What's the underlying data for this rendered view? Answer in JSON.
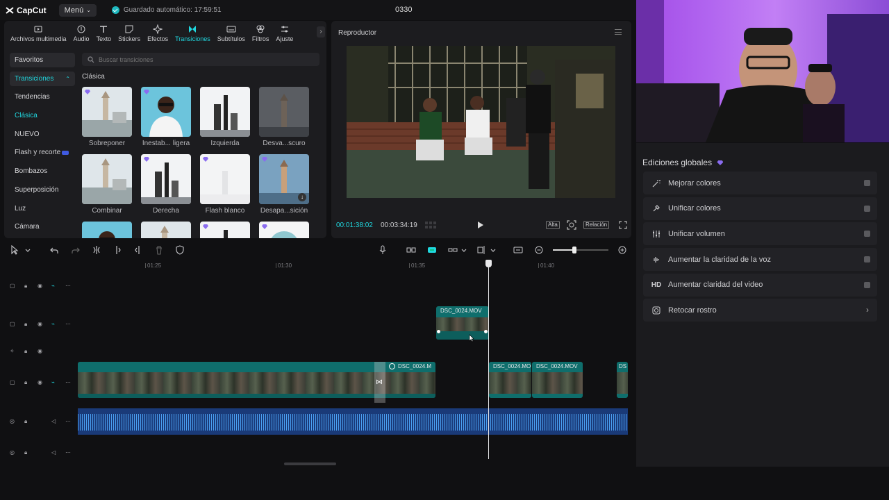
{
  "topbar": {
    "logo": "CapCut",
    "menu_label": "Menú",
    "autosave": "Guardado automático: 17:59:51",
    "project_title": "0330"
  },
  "tools": [
    {
      "label": "Archivos multimedia",
      "icon": "media-icon",
      "active": false
    },
    {
      "label": "Audio",
      "icon": "audio-icon",
      "active": false
    },
    {
      "label": "Texto",
      "icon": "text-icon",
      "active": false
    },
    {
      "label": "Stickers",
      "icon": "sticker-icon",
      "active": false
    },
    {
      "label": "Efectos",
      "icon": "effects-icon",
      "active": false
    },
    {
      "label": "Transiciones",
      "icon": "transitions-icon",
      "active": true
    },
    {
      "label": "Subtítulos",
      "icon": "subtitles-icon",
      "active": false
    },
    {
      "label": "Filtros",
      "icon": "filters-icon",
      "active": false
    },
    {
      "label": "Ajuste",
      "icon": "adjust-icon",
      "active": false
    }
  ],
  "categories": [
    {
      "label": "Favoritos",
      "selected": true
    },
    {
      "label": "Transiciones",
      "selected": true,
      "teal": true,
      "expanded": true
    },
    {
      "label": "Tendencias"
    },
    {
      "label": "Clásica",
      "teal": true
    },
    {
      "label": "NUEVO"
    },
    {
      "label": "Flash y recorte",
      "vip": true
    },
    {
      "label": "Bombazos"
    },
    {
      "label": "Superposición"
    },
    {
      "label": "Luz"
    },
    {
      "label": "Cámara"
    }
  ],
  "search": {
    "placeholder": "Buscar transiciones"
  },
  "section_label": "Clásica",
  "transitions": [
    {
      "label": "Sobreponer",
      "kind": "lighthouse-city",
      "premium": true
    },
    {
      "label": "Inestab... ligera",
      "kind": "person",
      "premium": true
    },
    {
      "label": "Izquierda",
      "kind": "tower",
      "premium": false
    },
    {
      "label": "Desva...scuro",
      "kind": "dark-tower",
      "premium": false
    },
    {
      "label": "Combinar",
      "kind": "lighthouse-city",
      "premium": false
    },
    {
      "label": "Derecha",
      "kind": "tower",
      "premium": true
    },
    {
      "label": "Flash blanco",
      "kind": "white",
      "premium": true
    },
    {
      "label": "Desapa...sición",
      "kind": "lighthouse-blue",
      "premium": true,
      "download": true
    },
    {
      "label": "",
      "kind": "person",
      "premium": false
    },
    {
      "label": "",
      "kind": "lighthouse-city",
      "premium": false
    },
    {
      "label": "",
      "kind": "tower",
      "premium": true
    },
    {
      "label": "",
      "kind": "circle",
      "premium": true
    }
  ],
  "player": {
    "title": "Reproductor",
    "current_time": "00:01:38:02",
    "total_time": "00:03:34:19",
    "quality": "Alta",
    "ratio": "Relación"
  },
  "global_edits": {
    "title": "Ediciones globales",
    "items": [
      {
        "label": "Mejorar colores",
        "icon": "magic-wand-icon",
        "type": "toggle"
      },
      {
        "label": "Unificar colores",
        "icon": "color-dropper-icon",
        "type": "toggle"
      },
      {
        "label": "Unificar volumen",
        "icon": "sliders-icon",
        "type": "toggle"
      },
      {
        "label": "Aumentar la claridad de la voz",
        "icon": "voice-sparkle-icon",
        "type": "toggle"
      },
      {
        "label": "Aumentar claridad del video",
        "icon": "hd-icon",
        "icon_text": "HD",
        "type": "toggle"
      },
      {
        "label": "Retocar rostro",
        "icon": "face-retouch-icon",
        "type": "arrow"
      }
    ]
  },
  "timeline": {
    "ruler": [
      "01:25",
      "01:30",
      "01:35",
      "01:40"
    ],
    "clips": {
      "overlay": "DSC_0024.MOV",
      "main1": "DSC_0024.M",
      "main2": "DSC_0024.MO",
      "main3": "DSC_0024.MOV",
      "main4": "DS"
    }
  },
  "colors": {
    "accent": "#20d7df",
    "clip": "#0f6e6c",
    "audio": "#1a3a78",
    "waveform": "#4aa0f2",
    "premium": "#8a6cf0"
  }
}
